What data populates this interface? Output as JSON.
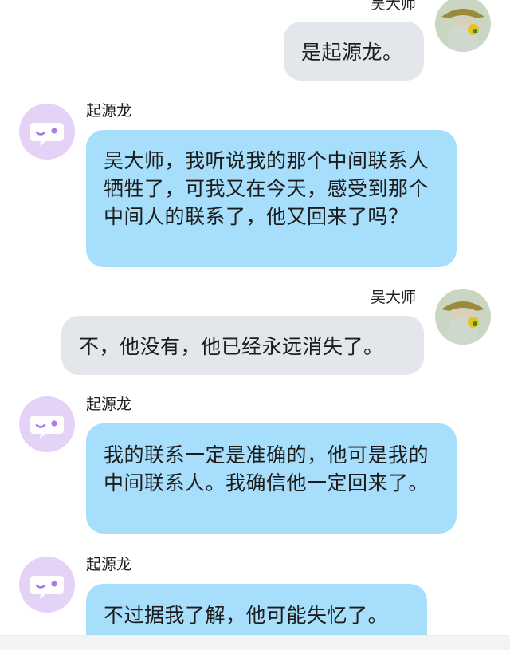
{
  "participants": {
    "wu": {
      "name": "吴大师",
      "avatar_icon": "robed-figure-avatar"
    },
    "qi": {
      "name": "起源龙",
      "avatar_icon": "chat-bubble-face-avatar"
    }
  },
  "messages": [
    {
      "sender": "wu",
      "side": "right",
      "text": "是起源龙。"
    },
    {
      "sender": "qi",
      "side": "left",
      "text": "吴大师，我听说我的那个中间联系人牺牲了，可我又在今天，感受到那个中间人的联系了，他又回来了吗？"
    },
    {
      "sender": "wu",
      "side": "right",
      "text": "不，他没有，他已经永远消失了。"
    },
    {
      "sender": "qi",
      "side": "left",
      "text": "我的联系一定是准确的，他可是我的中间联系人。我确信他一定回来了。"
    },
    {
      "sender": "qi",
      "side": "left",
      "text": "不过据我了解，他可能失忆了。"
    }
  ],
  "colors": {
    "right_bubble": "#e3e6ea",
    "left_bubble": "#a6defb",
    "default_avatar_bg": "#e4d2f7",
    "default_avatar_icon": "#a77de0"
  }
}
